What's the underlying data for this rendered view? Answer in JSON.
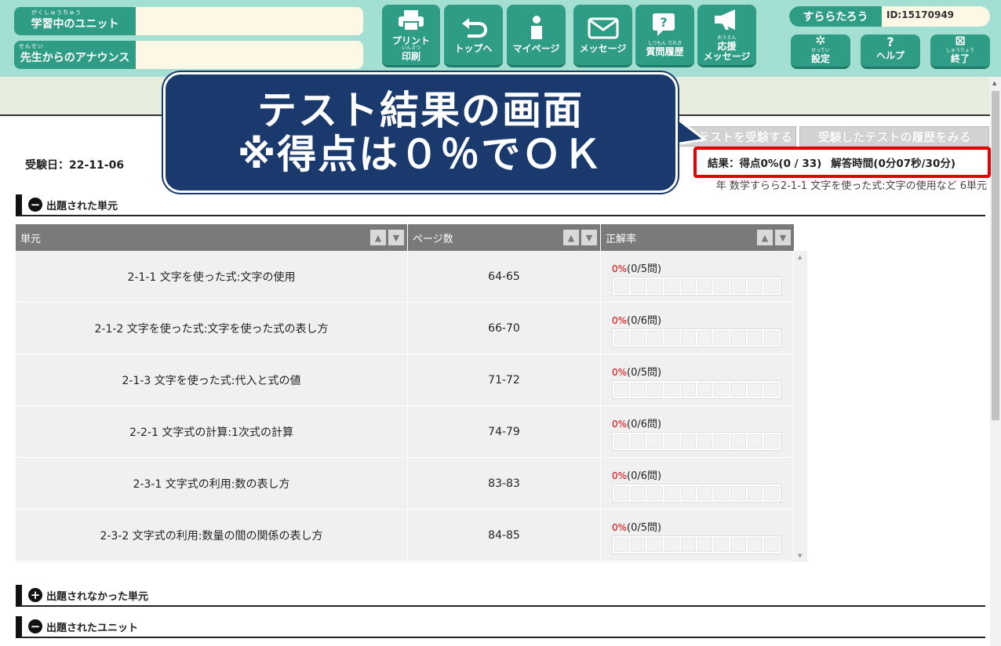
{
  "header": {
    "current_unit_label": "学習中のユニット",
    "current_unit_ruby": "がくしゅうちゅう",
    "announce_label": "先生からのアナウンス",
    "announce_ruby": "せんせい",
    "current_unit_value": "",
    "announce_value": "",
    "nav": [
      {
        "label": "プリント",
        "ruby": "いんさつ",
        "label2": "印刷"
      },
      {
        "label": "トップへ"
      },
      {
        "label": "マイページ"
      },
      {
        "label": "メッセージ"
      },
      {
        "ruby": "しつもん りれき",
        "label": "質問履歴"
      },
      {
        "ruby": "おうえん",
        "label": "応援",
        "label2": "メッセージ"
      }
    ],
    "user_name": "すららたろう",
    "user_id": "ID:15170949",
    "settings": {
      "ruby": "せってい",
      "label": "設定"
    },
    "help": {
      "label": "ヘルプ"
    },
    "quit": {
      "ruby": "しゅうりょう",
      "label": "終了"
    }
  },
  "actions": {
    "retake": "テストを受験する",
    "history": "受験したテストの履歴をみる"
  },
  "exam": {
    "date": "受験日：22-11-06",
    "result": "結果：得点0%(0 / 33)",
    "time": "解答時間(0分07秒/30分)",
    "course": "年 数学すらら2-1-1 文字を使った式:文字の使用など 6単元"
  },
  "sections": {
    "tested": "出題された単元",
    "not_tested": "出題されなかった単元",
    "units": "出題されたユニット"
  },
  "table": {
    "headers": [
      "単元",
      "ページ数",
      "正解率"
    ],
    "rows": [
      {
        "unit": "2-1-1 文字を使った式:文字の使用",
        "pages": "64-65",
        "pct": "0%",
        "count": "(0/5問)",
        "rate": 0
      },
      {
        "unit": "2-1-2 文字を使った式:文字を使った式の表し方",
        "pages": "66-70",
        "pct": "0%",
        "count": "(0/6問)",
        "rate": 0
      },
      {
        "unit": "2-1-3 文字を使った式:代入と式の値",
        "pages": "71-72",
        "pct": "0%",
        "count": "(0/5問)",
        "rate": 0
      },
      {
        "unit": "2-2-1 文字式の計算:1次式の計算",
        "pages": "74-79",
        "pct": "0%",
        "count": "(0/6問)",
        "rate": 0
      },
      {
        "unit": "2-3-1 文字式の利用:数の表し方",
        "pages": "83-83",
        "pct": "0%",
        "count": "(0/6問)",
        "rate": 0
      },
      {
        "unit": "2-3-2 文字式の利用:数量の間の関係の表し方",
        "pages": "84-85",
        "pct": "0%",
        "count": "(0/5問)",
        "rate": 0
      }
    ]
  },
  "callout": {
    "line1": "テスト結果の画面",
    "line2": "※得点は０％でＯＫ"
  },
  "colors": {
    "header_bg": "#a3dfd2",
    "button_green": "#2f9d86",
    "highlight_red": "#e60000",
    "callout_navy": "#1a3a6e"
  }
}
